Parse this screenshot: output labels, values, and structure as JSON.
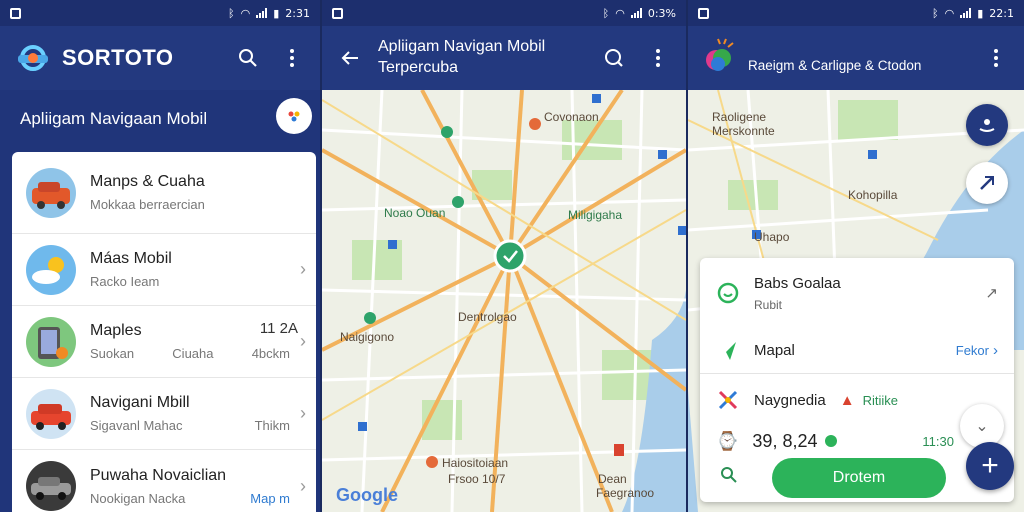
{
  "colors": {
    "primary": "#23397f",
    "accent_green": "#2cb35a",
    "link_blue": "#2f7bd0"
  },
  "status": {
    "time1": "2:31",
    "time2": "0:3%",
    "time3": "22:1"
  },
  "screen1": {
    "app_title": "SORTOTO",
    "subtitle": "Apliigam Navigaan Mobil",
    "items": [
      {
        "title": "Manps & Cuaha",
        "sub_left": "Mokkaa berraercian",
        "sub_right": "",
        "meta": "",
        "chevron": false,
        "thumb": "car-orange"
      },
      {
        "title": "Máas Mobil",
        "sub_left": "Racko Ieam",
        "sub_right": "",
        "meta": "",
        "chevron": true,
        "thumb": "weather-sun"
      },
      {
        "title": "Maples",
        "sub_left": "Suokan",
        "sub_mid": "Ciuaha",
        "sub_right": "4bckm",
        "meta": "11 2A",
        "chevron": true,
        "thumb": "device"
      },
      {
        "title": "Navigani Mbill",
        "sub_left": "Sigavanl Mahac",
        "sub_right": "Thikm",
        "meta": "",
        "chevron": true,
        "thumb": "car-red"
      },
      {
        "title": "Puwaha Novaiclian",
        "sub_left": "Nookigan Nacka",
        "sub_right": "Map m",
        "meta": "",
        "chevron": true,
        "thumb": "car-dark"
      }
    ]
  },
  "screen2": {
    "title_line1": "Apliigam Navigan Mobil",
    "title_line2": "Terpercuba",
    "labels": [
      "Covonaon",
      "Noao Ouan",
      "Miligigaha",
      "Dentrolgao",
      "Naigigono",
      "Haiositoiaan",
      "Frsoo 10/7",
      "Dean",
      "Faegranoo"
    ],
    "google": "Google"
  },
  "screen3": {
    "title": "Raeigm & Carligpe & Ctodon",
    "map_labels": [
      "Raoligene",
      "Merskonnte",
      "Kohopilla",
      "Uhapo"
    ],
    "panel": {
      "row1_title": "Babs Goalaa",
      "row1_sub": "Rubit",
      "row2_label": "Mapal",
      "row2_link": "Fekor",
      "row3_label": "Naygnedia",
      "row3_tag": "Ritiike",
      "row4_value": "39, 8,24",
      "row4_right": "11:30",
      "go_label": "Drotem"
    }
  }
}
